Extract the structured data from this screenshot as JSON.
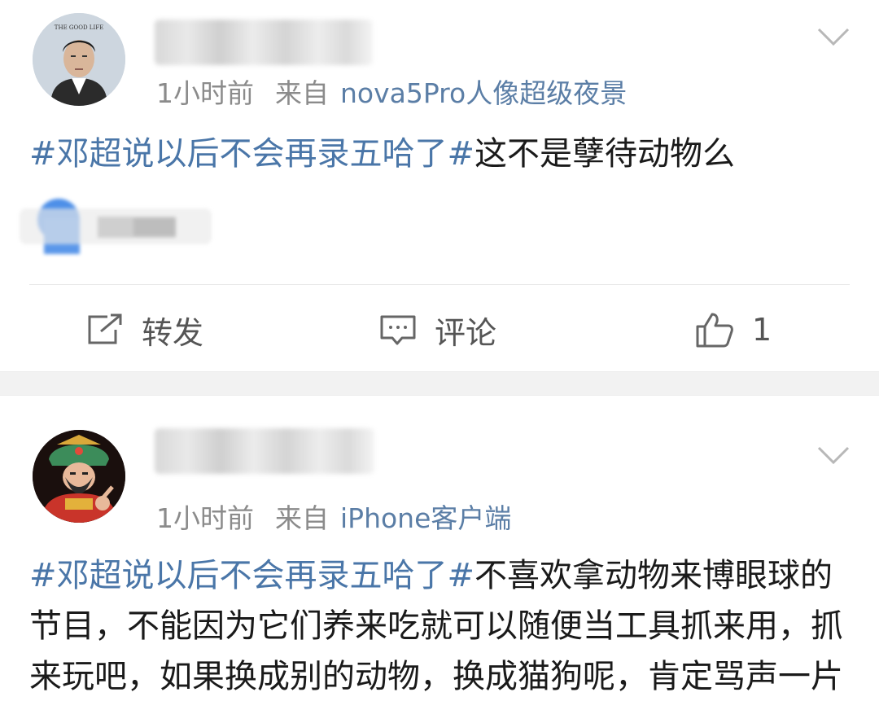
{
  "posts": [
    {
      "time": "1小时前",
      "source_prefix": "来自",
      "source": "nova5Pro人像超级夜景",
      "topic": "#邓超说以后不会再录五哈了#",
      "text": "这不是孽待动物么",
      "avatar_caption": "THE GOOD LIFE",
      "actions": {
        "repost": "转发",
        "comment": "评论",
        "like_count": "1"
      }
    },
    {
      "time": "1小时前",
      "source_prefix": "来自",
      "source": "iPhone客户端",
      "topic": "#邓超说以后不会再录五哈了#",
      "text": "不喜欢拿动物来博眼球的节目，不能因为它们养来吃就可以随便当工具抓来用，抓来玩吧，如果换成别的动物，换成猫狗呢，肯定骂声一片"
    }
  ],
  "colors": {
    "topic": "#4a76a8",
    "meta": "#8b8b8b",
    "source": "#5b7ea6",
    "separator": "#f2f2f2"
  },
  "icons": [
    "chevron-down-icon",
    "repost-icon",
    "comment-icon",
    "like-icon"
  ]
}
